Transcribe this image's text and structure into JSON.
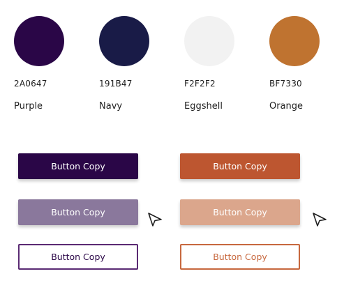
{
  "palette": [
    {
      "hex": "2A0647",
      "name": "Purple",
      "color": "#2A0647"
    },
    {
      "hex": "191B47",
      "name": "Navy",
      "color": "#191B47"
    },
    {
      "hex": "F2F2F2",
      "name": "Eggshell",
      "color": "#F2F2F2"
    },
    {
      "hex": "BF7330",
      "name": "Orange",
      "color": "#BF7330"
    }
  ],
  "buttons": {
    "purple": {
      "default_label": "Button Copy",
      "hover_label": "Button Copy",
      "outline_label": "Button Copy",
      "default_bg": "#2A0647",
      "hover_bg": "#8A789C",
      "outline_border": "#5A2A73",
      "outline_text": "#2A0647",
      "text_color": "#FFFFFF"
    },
    "orange": {
      "default_label": "Button Copy",
      "hover_label": "Button Copy",
      "outline_label": "Button Copy",
      "default_bg": "#BD5630",
      "hover_bg": "#DBA68C",
      "outline_border": "#C7683E",
      "outline_text": "#C7683E",
      "text_color": "#FFFFFF"
    }
  },
  "icons": {
    "cursor": "cursor-arrow-icon"
  }
}
